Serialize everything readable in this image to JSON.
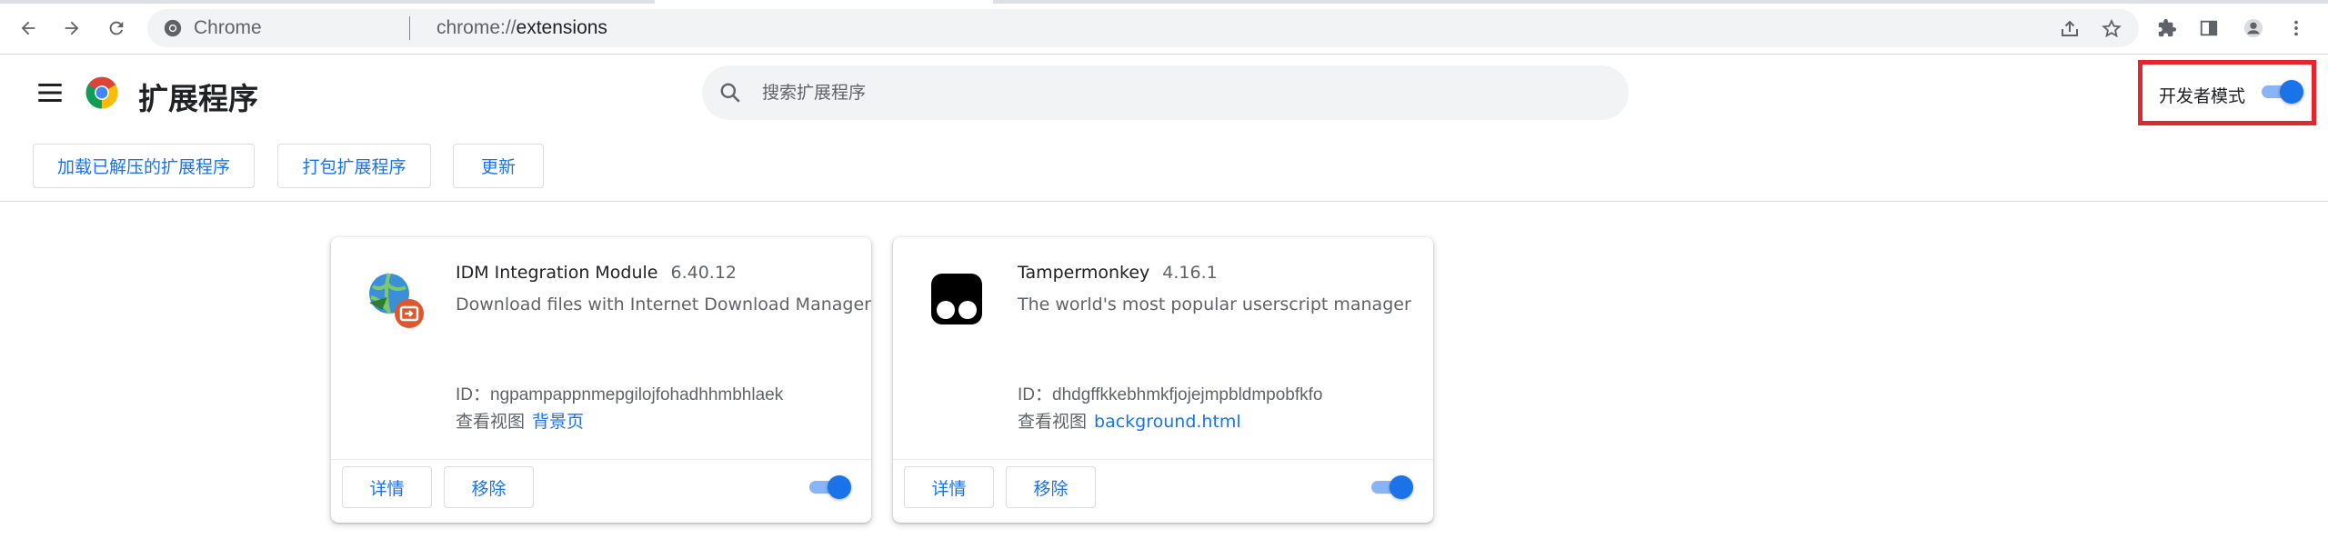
{
  "browser": {
    "omnibox_site_label": "Chrome",
    "omnibox_url_scheme": "chrome://",
    "omnibox_url_path": "extensions"
  },
  "page": {
    "title": "扩展程序",
    "search_placeholder": "搜索扩展程序",
    "developer_mode_label": "开发者模式",
    "developer_mode_enabled": true,
    "actions": {
      "load_unpacked": "加载已解压的扩展程序",
      "pack_extension": "打包扩展程序",
      "update": "更新"
    }
  },
  "extensions": [
    {
      "name": "IDM Integration Module",
      "version": "6.40.12",
      "description": "Download files with Internet Download Manager",
      "id_label": "ID：",
      "id": "ngpampappnmepgilojfohadhhmbhlaek",
      "views_label": "查看视图",
      "view_link": "背景页",
      "details_label": "详情",
      "remove_label": "移除",
      "enabled": true,
      "icon": "idm-globe-icon"
    },
    {
      "name": "Tampermonkey",
      "version": "4.16.1",
      "description": "The world's most popular userscript manager",
      "id_label": "ID：",
      "id": "dhdgffkkebhmkfjojejmpbldmpobfkfo",
      "views_label": "查看视图",
      "view_link": "background.html",
      "details_label": "详情",
      "remove_label": "移除",
      "enabled": true,
      "icon": "tampermonkey-icon"
    }
  ],
  "colors": {
    "accent": "#1a73e8",
    "toggle_track": "#8ab4f8",
    "highlight_border": "#e3262c",
    "search_bg": "#f1f3f4"
  }
}
